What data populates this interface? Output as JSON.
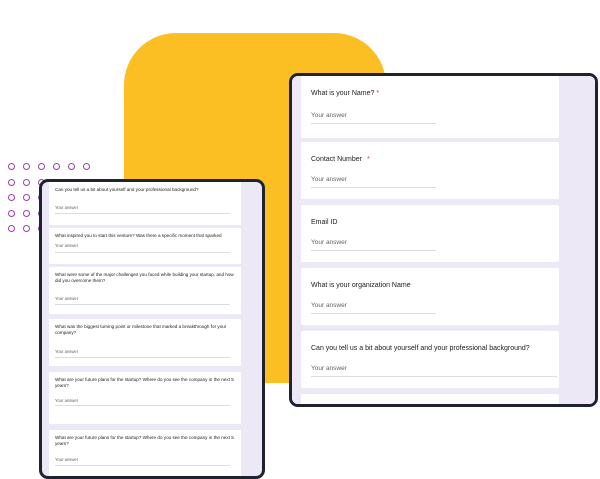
{
  "colors": {
    "accent_yellow": "#FBBF24",
    "dot_purple": "#9D3FA8",
    "form_background": "#ECE8F6",
    "tablet_frame": "#1f2330",
    "required_red": "#d93025"
  },
  "right_form": {
    "questions": [
      {
        "label": "What is your Name?",
        "required": "*",
        "answer_placeholder": "Your answer"
      },
      {
        "label": "Contact Number",
        "required": "*",
        "answer_placeholder": "Your answer"
      },
      {
        "label": "Email ID",
        "required": "",
        "answer_placeholder": "Your answer"
      },
      {
        "label": "What is your organization Name",
        "required": "",
        "answer_placeholder": "Your answer"
      },
      {
        "label": "Can you tell us a bit about yourself and your professional background?",
        "required": "",
        "answer_placeholder": "Your answer"
      }
    ]
  },
  "left_form": {
    "questions": [
      {
        "label": "Can you tell us a bit about yourself and your professional background?",
        "answer_placeholder": "Your answer"
      },
      {
        "label": "What inspired you to start this venture? Was there a specific moment that sparked",
        "answer_placeholder": "Your answer"
      },
      {
        "label": "What were some of the major challenges you faced while building your startup, and how did you overcome them?",
        "answer_placeholder": "Your answer"
      },
      {
        "label": "What was the biggest turning point or milestone that marked a breakthrough for your company?",
        "answer_placeholder": "Your answer"
      },
      {
        "label": "What are your future plans for the startup? Where do you see the company in the next 5 years?",
        "answer_placeholder": "Your answer"
      },
      {
        "label": "What are your future plans for the startup? Where do you see the company in the next 5 years?",
        "answer_placeholder": "Your answer"
      }
    ]
  }
}
